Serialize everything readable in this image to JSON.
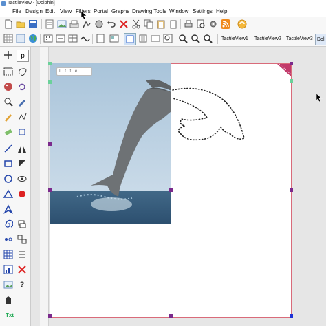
{
  "window": {
    "title": "TactileView - [Dolphin]"
  },
  "menu": [
    "File",
    "Design",
    "Edit",
    "View",
    "Filters",
    "Portal",
    "Graphs",
    "Drawing Tools",
    "Window",
    "Settings",
    "Help"
  ],
  "view_tabs": [
    "TactileView1",
    "TactileView2",
    "TactileView3",
    "Dol"
  ],
  "canvas": {
    "chip_text": "T t t e",
    "accent": "#d96b7a",
    "handle_color": "#7b2a8c"
  },
  "left_tools": [
    "move-icon",
    "select-icon",
    "freehand-icon",
    "eraser-icon",
    "line-icon",
    "rectangle-icon",
    "circle-icon",
    "triangle-icon",
    "text-icon",
    "help-icon"
  ],
  "left_labels": {
    "text_tool": "Txt",
    "help_tool": "?",
    "p_tool": "p"
  }
}
